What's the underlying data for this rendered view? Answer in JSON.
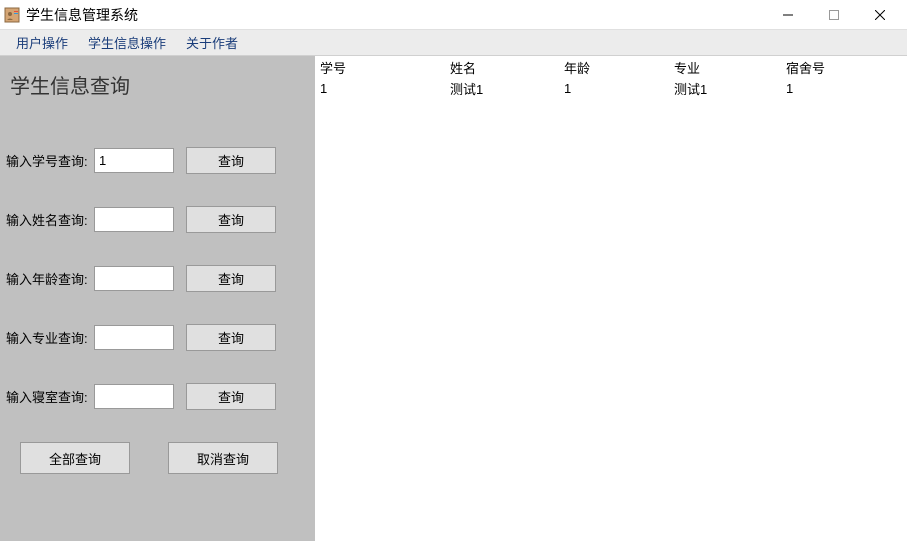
{
  "titlebar": {
    "title": "学生信息管理系统"
  },
  "menubar": {
    "items": [
      "用户操作",
      "学生信息操作",
      "关于作者"
    ]
  },
  "sidebar": {
    "title": "学生信息查询",
    "queries": [
      {
        "label": "输入学号查询:",
        "value": "1",
        "button": "查询"
      },
      {
        "label": "输入姓名查询:",
        "value": "",
        "button": "查询"
      },
      {
        "label": "输入年龄查询:",
        "value": "",
        "button": "查询"
      },
      {
        "label": "输入专业查询:",
        "value": "",
        "button": "查询"
      },
      {
        "label": "输入寝室查询:",
        "value": "",
        "button": "查询"
      }
    ],
    "buttons": {
      "all": "全部查询",
      "cancel": "取消查询"
    }
  },
  "table": {
    "headers": [
      "学号",
      "姓名",
      "年龄",
      "专业",
      "宿舍号"
    ],
    "rows": [
      [
        "1",
        "测试1",
        "1",
        "测试1",
        "1"
      ]
    ]
  }
}
